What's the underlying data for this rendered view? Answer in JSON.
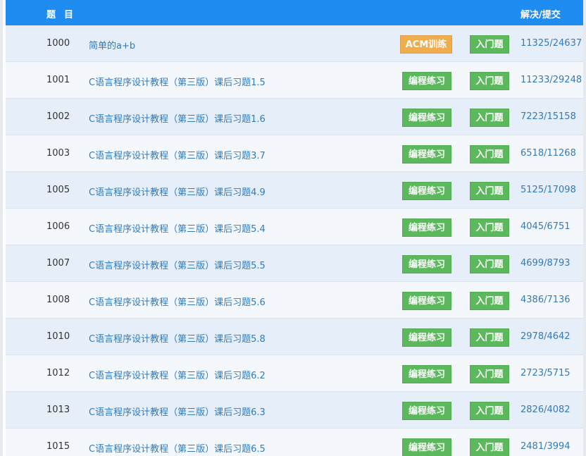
{
  "header": {
    "title_label": "题目",
    "stats_label": "解决/提交"
  },
  "colors": {
    "header_bg": "#1e8cf0",
    "link": "#337ab7",
    "tag_orange": "#f0ad4e",
    "tag_green": "#5cb85c",
    "row_odd": "#e6eef9",
    "row_even": "#f4f8fd"
  },
  "rows": [
    {
      "id": "1000",
      "title": "简单的a+b",
      "tag": "ACM训练",
      "tag_type": "acm",
      "level": "入门题",
      "solved": "11325",
      "submitted": "24637"
    },
    {
      "id": "1001",
      "title": "C语言程序设计教程（第三版）课后习题1.5",
      "tag": "编程练习",
      "tag_type": "prog",
      "level": "入门题",
      "solved": "11233",
      "submitted": "29248"
    },
    {
      "id": "1002",
      "title": "C语言程序设计教程（第三版）课后习题1.6",
      "tag": "编程练习",
      "tag_type": "prog",
      "level": "入门题",
      "solved": "7223",
      "submitted": "15158"
    },
    {
      "id": "1003",
      "title": "C语言程序设计教程（第三版）课后习题3.7",
      "tag": "编程练习",
      "tag_type": "prog",
      "level": "入门题",
      "solved": "6518",
      "submitted": "11268"
    },
    {
      "id": "1005",
      "title": "C语言程序设计教程（第三版）课后习题4.9",
      "tag": "编程练习",
      "tag_type": "prog",
      "level": "入门题",
      "solved": "5125",
      "submitted": "17098"
    },
    {
      "id": "1006",
      "title": "C语言程序设计教程（第三版）课后习题5.4",
      "tag": "编程练习",
      "tag_type": "prog",
      "level": "入门题",
      "solved": "4045",
      "submitted": "6751"
    },
    {
      "id": "1007",
      "title": "C语言程序设计教程（第三版）课后习题5.5",
      "tag": "编程练习",
      "tag_type": "prog",
      "level": "入门题",
      "solved": "4699",
      "submitted": "8793"
    },
    {
      "id": "1008",
      "title": "C语言程序设计教程（第三版）课后习题5.6",
      "tag": "编程练习",
      "tag_type": "prog",
      "level": "入门题",
      "solved": "4386",
      "submitted": "7136"
    },
    {
      "id": "1010",
      "title": "C语言程序设计教程（第三版）课后习题5.8",
      "tag": "编程练习",
      "tag_type": "prog",
      "level": "入门题",
      "solved": "2978",
      "submitted": "4642"
    },
    {
      "id": "1012",
      "title": "C语言程序设计教程（第三版）课后习题6.2",
      "tag": "编程练习",
      "tag_type": "prog",
      "level": "入门题",
      "solved": "2723",
      "submitted": "5715"
    },
    {
      "id": "1013",
      "title": "C语言程序设计教程（第三版）课后习题6.3",
      "tag": "编程练习",
      "tag_type": "prog",
      "level": "入门题",
      "solved": "2826",
      "submitted": "4082"
    },
    {
      "id": "1015",
      "title": "C语言程序设计教程（第三版）课后习题6.5",
      "tag": "编程练习",
      "tag_type": "prog",
      "level": "入门题",
      "solved": "2481",
      "submitted": "3994"
    }
  ]
}
